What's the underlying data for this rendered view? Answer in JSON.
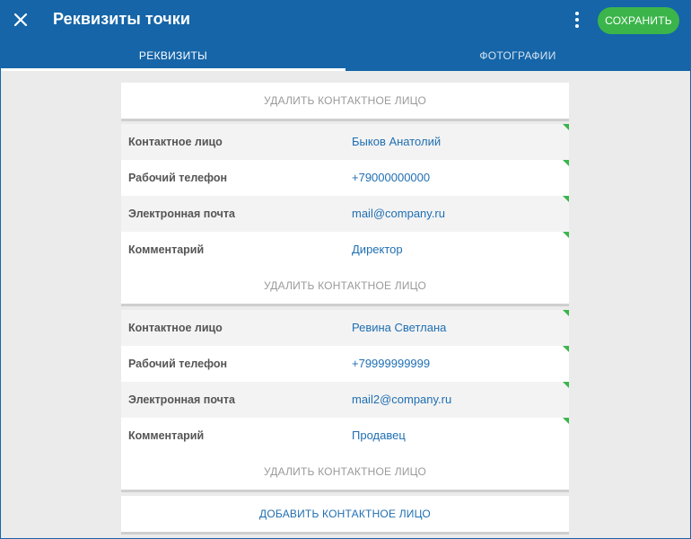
{
  "header": {
    "title": "Реквизиты точки",
    "save_label": "СОХРАНИТЬ",
    "close_icon": "close-icon",
    "menu_icon": "more-vertical-icon",
    "bg_color": "#1565a8",
    "save_color": "#3bb54a"
  },
  "tabs": [
    {
      "label": "РЕКВИЗИТЫ",
      "active": true
    },
    {
      "label": "ФОТОГРАФИИ",
      "active": false
    }
  ],
  "actions": {
    "delete_label": "УДАЛИТЬ КОНТАКТНОЕ ЛИЦО",
    "add_label": "ДОБАВИТЬ КОНТАКТНОЕ ЛИЦО"
  },
  "contacts": [
    {
      "fields": [
        {
          "label": "Контактное лицо",
          "value": "Быков Анатолий"
        },
        {
          "label": "Рабочий телефон",
          "value": "+79000000000"
        },
        {
          "label": "Электронная почта",
          "value": "mail@company.ru"
        },
        {
          "label": "Комментарий",
          "value": "Директор"
        }
      ]
    },
    {
      "fields": [
        {
          "label": "Контактное лицо",
          "value": "Ревина Светлана"
        },
        {
          "label": "Рабочий телефон",
          "value": "+79999999999"
        },
        {
          "label": "Электронная почта",
          "value": "mail2@company.ru"
        },
        {
          "label": "Комментарий",
          "value": "Продавец"
        }
      ]
    }
  ]
}
